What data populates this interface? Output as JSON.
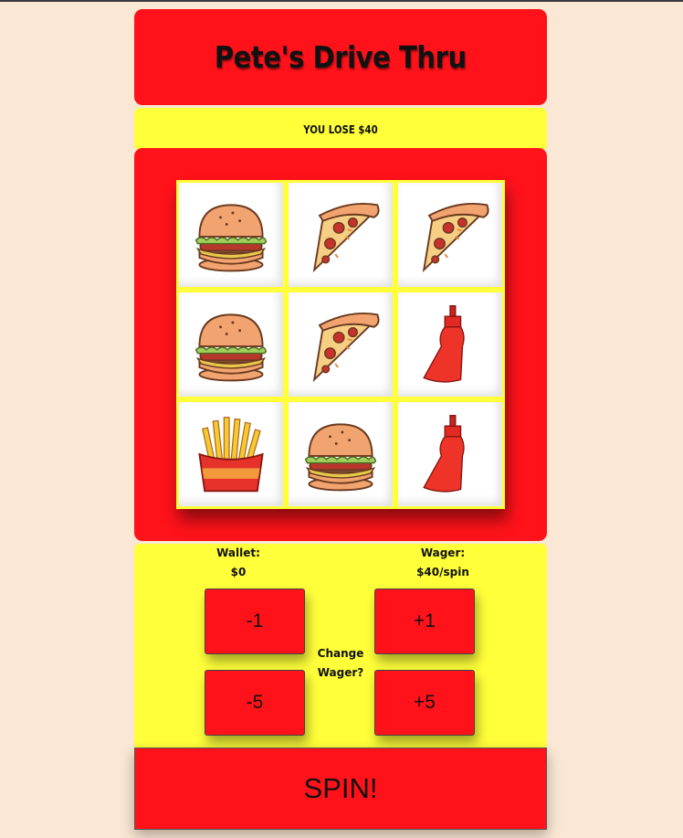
{
  "header": {
    "title": "Pete's Drive Thru"
  },
  "status": {
    "message": "YOU LOSE $40"
  },
  "reels": [
    [
      "burger",
      "pizza",
      "pizza"
    ],
    [
      "burger",
      "pizza",
      "ketchup"
    ],
    [
      "fries",
      "burger",
      "ketchup"
    ]
  ],
  "wallet": {
    "label": "Wallet:",
    "value": "$0"
  },
  "wager": {
    "label": "Wager:",
    "value": "$40/spin",
    "change_label_1": "Change",
    "change_label_2": "Wager?"
  },
  "buttons": {
    "minus_one": "-1",
    "plus_one": "+1",
    "minus_five": "-5",
    "plus_five": "+5",
    "spin": "SPIN!"
  },
  "colors": {
    "red": "#ff121a",
    "yellow": "#ffff3a",
    "background": "#fae7d4"
  }
}
